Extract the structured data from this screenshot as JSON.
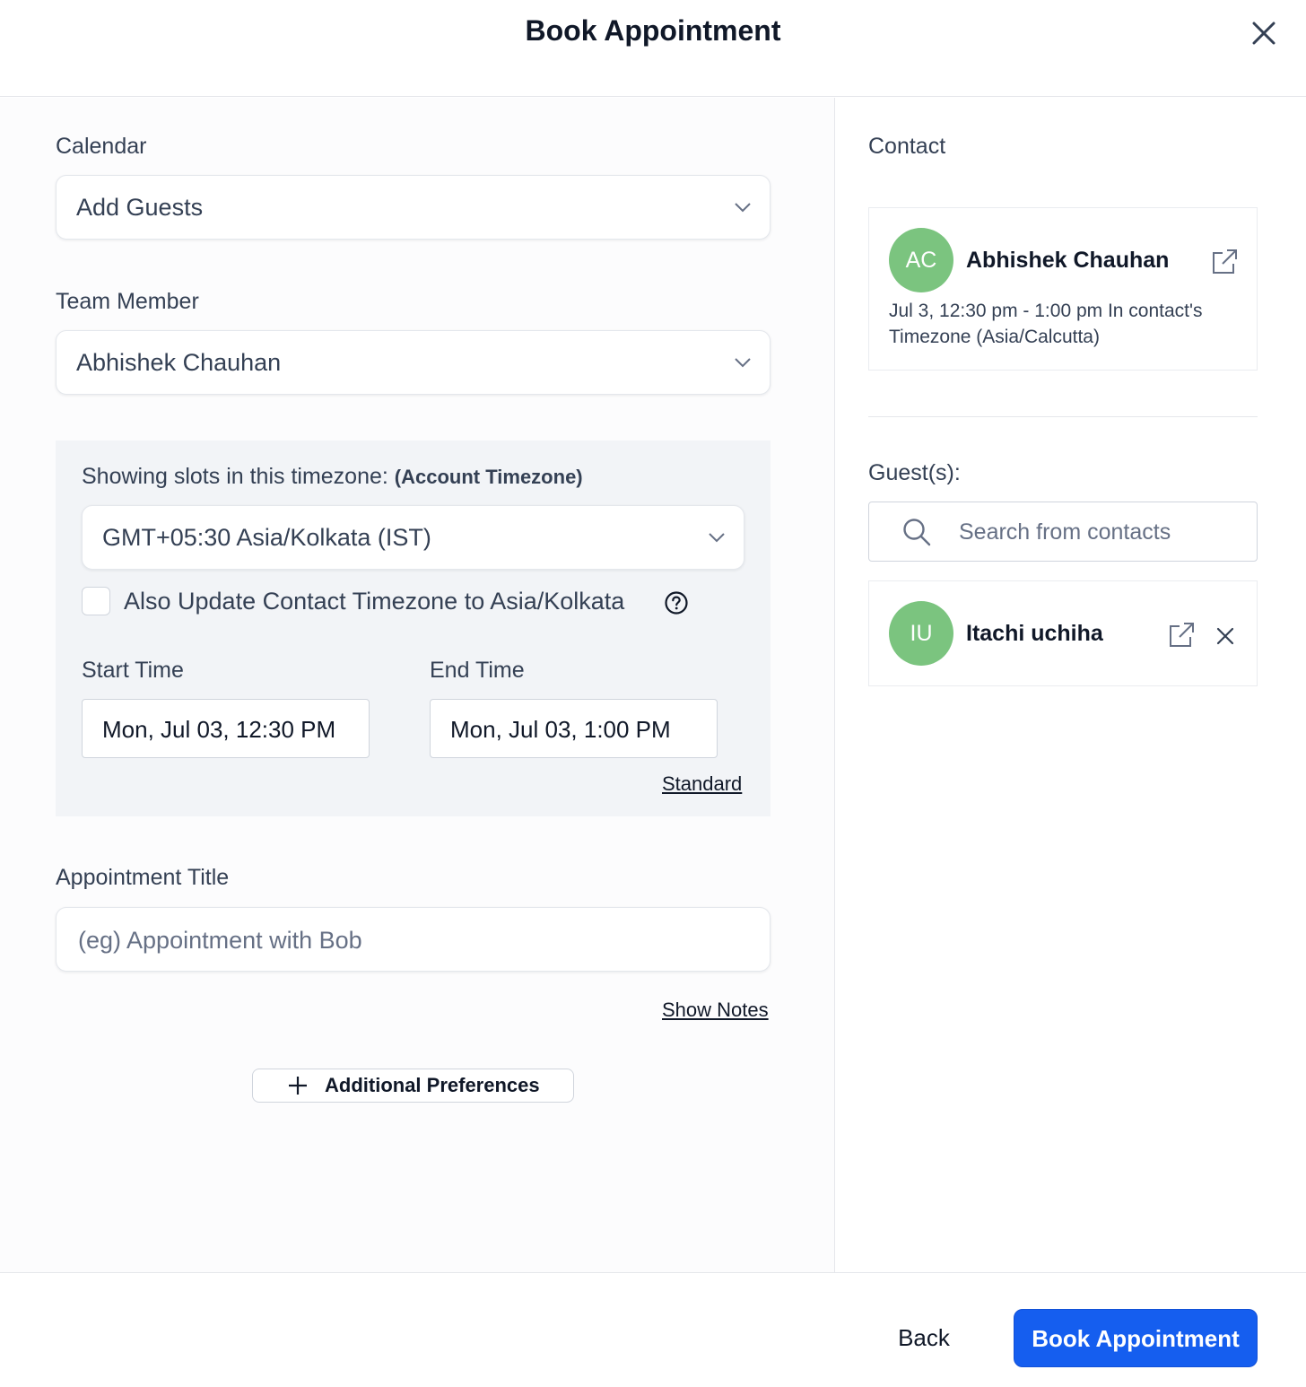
{
  "modal": {
    "title": "Book Appointment",
    "close_icon": "close-icon"
  },
  "form": {
    "calendar": {
      "label": "Calendar",
      "value": "Add Guests"
    },
    "team_member": {
      "label": "Team Member",
      "value": "Abhishek Chauhan"
    },
    "timezone": {
      "heading": "Showing slots in this timezone:",
      "heading_note": "(Account Timezone)",
      "value": "GMT+05:30 Asia/Kolkata (IST)",
      "checkbox_label": "Also Update Contact Timezone to Asia/Kolkata",
      "checkbox_checked": false,
      "start_label": "Start Time",
      "start_value": "Mon, Jul 03, 12:30 PM",
      "end_label": "End Time",
      "end_value": "Mon, Jul 03, 1:00 PM",
      "mode_link": "Standard"
    },
    "appointment_title": {
      "label": "Appointment Title",
      "placeholder": "(eg) Appointment with Bob",
      "value": ""
    },
    "show_notes_link": "Show Notes",
    "additional_preferences_label": "Additional Preferences"
  },
  "contact_panel": {
    "label": "Contact",
    "contact": {
      "initials": "AC",
      "name": "Abhishek Chauhan",
      "detail": "Jul 3, 12:30 pm - 1:00 pm In contact's Timezone (Asia/Calcutta)"
    },
    "guests_label": "Guest(s):",
    "search_placeholder": "Search from contacts",
    "guests": [
      {
        "initials": "IU",
        "name": "Itachi uchiha"
      }
    ]
  },
  "footer": {
    "back_label": "Back",
    "submit_label": "Book Appointment"
  },
  "colors": {
    "primary": "#155eef",
    "avatar": "#7bc47f",
    "panel_bg": "#f2f4f7"
  }
}
